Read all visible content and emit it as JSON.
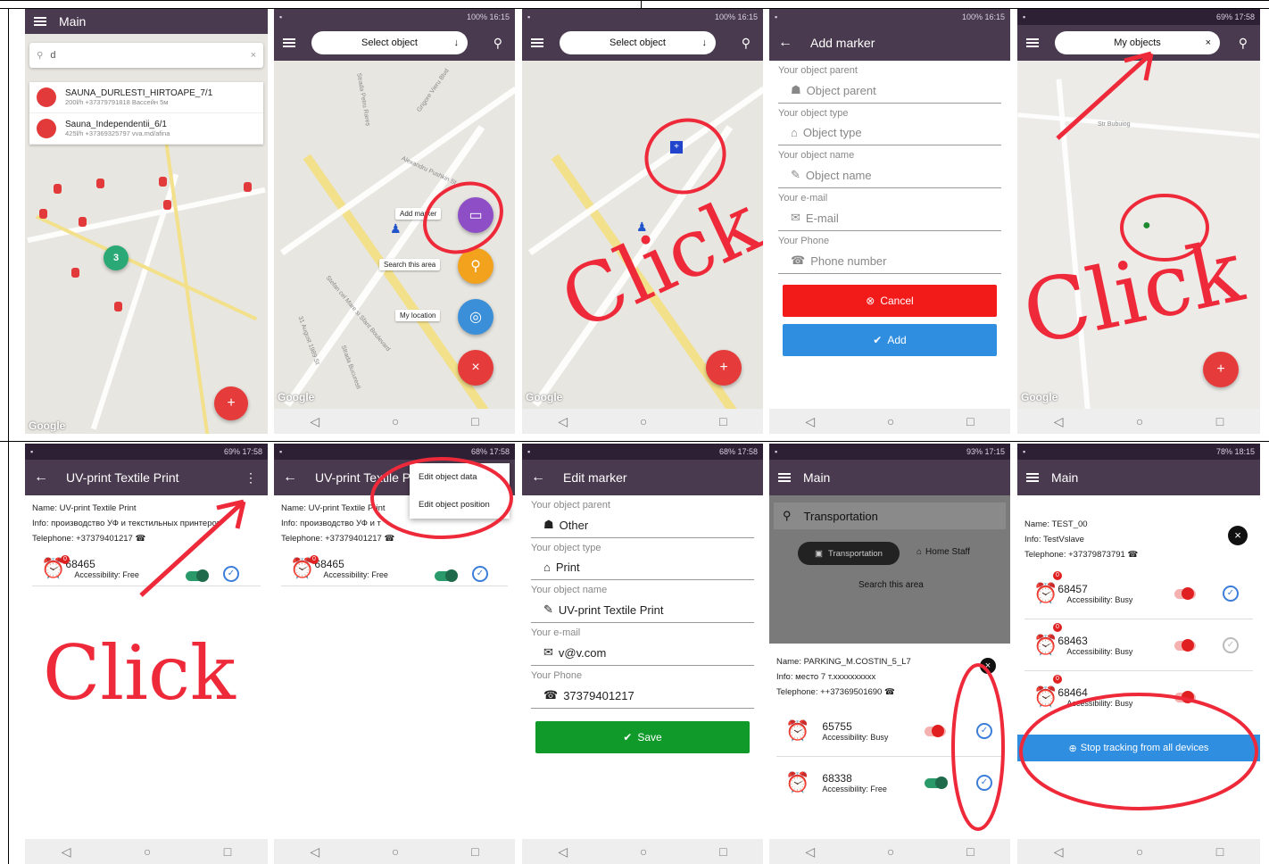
{
  "s1": {
    "title": "Main",
    "search_value": "d",
    "results": [
      {
        "name": "SAUNA_DURLESTI_HIRTOAPE_7/1",
        "sub": "200l/h +37379791818 Вассейн 5м"
      },
      {
        "name": "Sauna_Independentii_6/1",
        "sub": "425l/h +37369325797 vva.md/afina"
      }
    ],
    "cluster": "3",
    "google": "Google"
  },
  "s2": {
    "status_time": "100% 16:15",
    "select": "Select object",
    "chips": [
      "Add marker",
      "Search this area",
      "My location"
    ],
    "streets": [
      "Grigore Vieru Blvd",
      "Strada Petru Rareș",
      "Alexandru Pushkin St",
      "Stefan cel Mare si Sfant Boulevard",
      "31 August 1989 St",
      "Strada Bucuresti"
    ],
    "google": "Google"
  },
  "s3": {
    "status_time": "100% 16:15",
    "select": "Select object",
    "annotation": "Click",
    "google": "Google"
  },
  "s4": {
    "status_time": "100% 16:15",
    "title": "Add marker",
    "fields": [
      {
        "label": "Your object parent",
        "placeholder": "Object parent"
      },
      {
        "label": "Your object type",
        "placeholder": "Object type"
      },
      {
        "label": "Your object name",
        "placeholder": "Object name"
      },
      {
        "label": "Your e-mail",
        "placeholder": "E-mail"
      },
      {
        "label": "Your Phone",
        "placeholder": "Phone number"
      }
    ],
    "cancel": "Cancel",
    "add": "Add"
  },
  "s5": {
    "status_time": "69% 17:58",
    "select": "My objects",
    "street": "Str Bubuiog",
    "annotation": "Click",
    "google": "Google"
  },
  "s6": {
    "status_time": "69% 17:58",
    "title": "UV-print Textile Print",
    "name": "Name: UV-print Textile Print",
    "info": "Info: производство УФ и текстильных принтеров",
    "phone": "Telephone: +37379401217",
    "device": "68465",
    "badge": "0",
    "acc": "Accessibility: Free",
    "annotation": "Click"
  },
  "s7": {
    "status_time": "68% 17:58",
    "title": "UV-print Textile Print",
    "name": "Name: UV-print Textile Print",
    "info": "Info: производство УФ и т",
    "phone": "Telephone: +37379401217",
    "menu": [
      "Edit object data",
      "Edit object position"
    ],
    "device": "68465",
    "badge": "0",
    "acc": "Accessibility: Free"
  },
  "s8": {
    "status_time": "68% 17:58",
    "title": "Edit marker",
    "fields": [
      {
        "label": "Your object parent",
        "value": "Other"
      },
      {
        "label": "Your object type",
        "value": "Print"
      },
      {
        "label": "Your object name",
        "value": "UV-print Textile Print"
      },
      {
        "label": "Your e-mail",
        "value": "v@v.com"
      },
      {
        "label": "Your Phone",
        "value": "37379401217"
      }
    ],
    "save": "Save"
  },
  "s9": {
    "status_time": "93% 17:15",
    "title": "Main",
    "search": "Transportation",
    "chip_active": "Transportation",
    "chip2": "Home Staff",
    "search_area": "Search this area",
    "name": "Name: PARKING_M.COSTIN_5_L7",
    "info": "Info: место 7 т.хххххххххх",
    "phone": "Telephone: ++37369501690",
    "devices": [
      {
        "num": "65755",
        "acc": "Accessibility: Busy"
      },
      {
        "num": "68338",
        "acc": "Accessibility: Free"
      }
    ]
  },
  "s10": {
    "status_time": "78% 18:15",
    "title": "Main",
    "name": "Name: TEST_00",
    "info": "Info: TestVslave",
    "phone": "Telephone: +37379873791",
    "devices": [
      {
        "num": "68457",
        "acc": "Accessibility: Busy",
        "badge": "0"
      },
      {
        "num": "68463",
        "acc": "Accessibility: Busy",
        "badge": "0"
      },
      {
        "num": "68464",
        "acc": "Accessibility: Busy",
        "badge": "0"
      }
    ],
    "stop": "Stop tracking from all devices"
  },
  "colors": {
    "appbar": "#4a3a4f",
    "red": "#f31a1a",
    "blue": "#2f8ee0",
    "green": "#0f9a2a",
    "annotation": "#ee2a3a"
  }
}
